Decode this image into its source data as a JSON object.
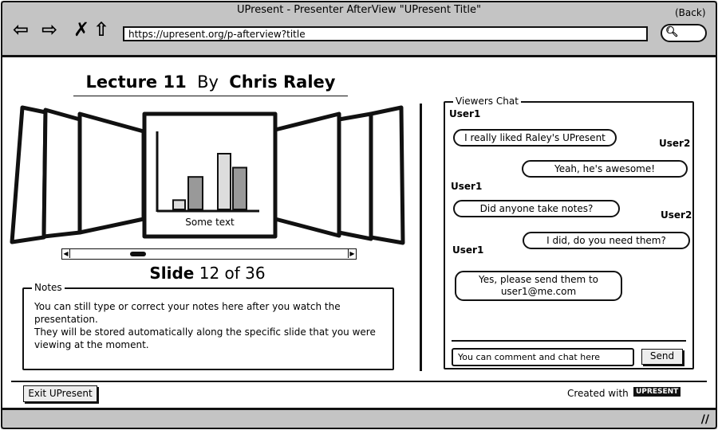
{
  "window": {
    "title": "UPresent - Presenter AfterView \"UPresent Title\"",
    "back_label": "(Back)",
    "url": "https://upresent.org/p-afterview?title"
  },
  "header": {
    "lecture": "Lecture 11",
    "by": "By",
    "author": "Chris Raley"
  },
  "slide": {
    "caption": "Some text",
    "label": "Slide",
    "current": "12 of 36",
    "bars": [
      1,
      3.5,
      6,
      4.5
    ],
    "scroll_position": 0.25
  },
  "notes": {
    "legend": "Notes",
    "text": "You can still type or correct your notes here after you watch the presentation.\nThey will be stored automatically along the specific slide that you were viewing at the moment."
  },
  "chat": {
    "legend": "Viewers Chat",
    "messages": [
      {
        "user": "User1",
        "text": "I really liked Raley's UPresent"
      },
      {
        "user": "User2",
        "text": "Yeah, he's awesome!"
      },
      {
        "user": "User1",
        "text": "Did anyone take notes?"
      },
      {
        "user": "User2",
        "text": "I did, do you need them?"
      },
      {
        "user": "User1",
        "text": "Yes, please send them to user1@me.com"
      }
    ],
    "input_placeholder": "You can comment and chat here",
    "send_label": "Send"
  },
  "footer": {
    "exit_label": "Exit UPresent",
    "created_with": "Created with",
    "logo": "UPRESENT"
  }
}
